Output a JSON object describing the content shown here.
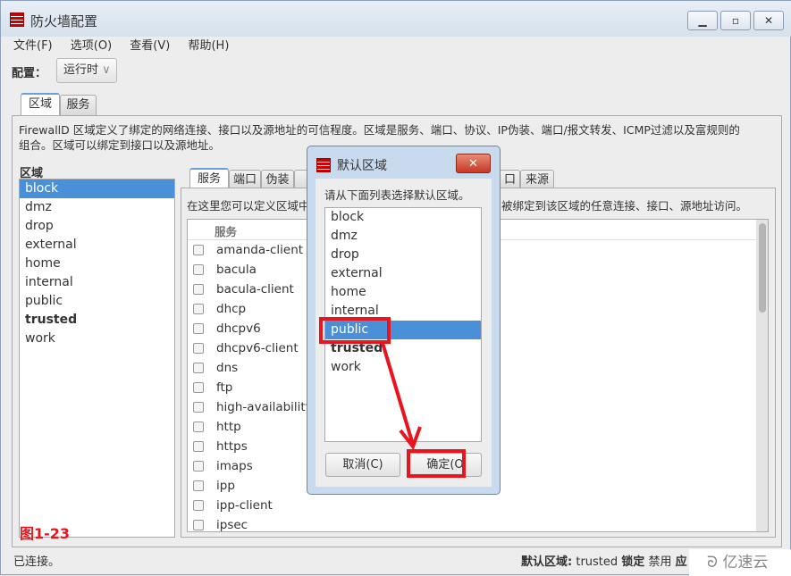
{
  "window": {
    "title": "防火墙配置",
    "buttons": [
      "minimize",
      "maximize",
      "close"
    ]
  },
  "menu": [
    "文件(F)",
    "选项(O)",
    "查看(V)",
    "帮助(H)"
  ],
  "config": {
    "label": "配置：",
    "value": "运行时"
  },
  "main_tabs": [
    "区域",
    "服务"
  ],
  "description": [
    "FirewallD 区域定义了绑定的网络连接、接口以及源地址的可信程度。区域是服务、端口、协议、IP伪装、端口/报文转发、ICMP过滤以及富规则的",
    "组合。区域可以绑定到接口以及源地址。"
  ],
  "zones": {
    "label": "区域",
    "items": [
      "block",
      "dmz",
      "drop",
      "external",
      "home",
      "internal",
      "public",
      "trusted",
      "work"
    ],
    "selected": "block",
    "bold": "trusted"
  },
  "inner_tabs": {
    "left": [
      "服务",
      "端口",
      "伪装"
    ],
    "right": [
      "口",
      "来源"
    ]
  },
  "services": {
    "hint": "在这里您可以定义区域中",
    "hint_right": "被绑定到该区域的任意连接、接口、源地址访问。",
    "column": "服务",
    "items": [
      "amanda-client",
      "bacula",
      "bacula-client",
      "dhcp",
      "dhcpv6",
      "dhcpv6-client",
      "dns",
      "ftp",
      "high-availability",
      "http",
      "https",
      "imaps",
      "ipp",
      "ipp-client",
      "ipsec"
    ]
  },
  "figure_label": "图1-23",
  "status": {
    "left": "已连接。",
    "default_zone_label": "默认区域:",
    "default_zone": "trusted",
    "lock_label": "锁定",
    "lock_value": "禁用",
    "trailing": "应"
  },
  "watermark": "亿速云",
  "dialog": {
    "title": "默认区域",
    "prompt": "请从下面列表选择默认区域。",
    "items": [
      "block",
      "dmz",
      "drop",
      "external",
      "home",
      "internal",
      "public",
      "trusted",
      "work"
    ],
    "selected": "public",
    "bold": "trusted",
    "cancel": "取消(C)",
    "ok": "确定(O"
  },
  "colors": {
    "selection": "#4a90d9",
    "annotation": "#e8141e"
  }
}
